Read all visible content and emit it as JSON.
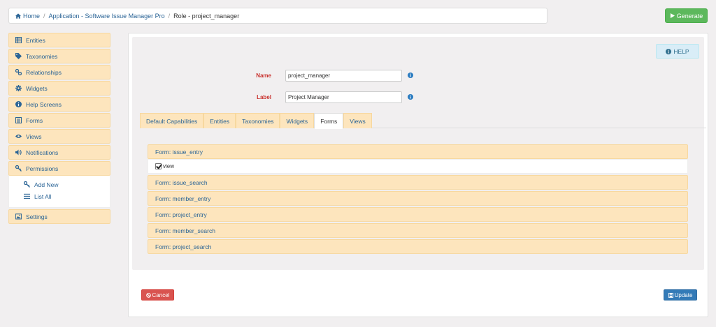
{
  "breadcrumb": {
    "home": "Home",
    "application": "Application - Software Issue Manager Pro",
    "current": "Role - project_manager"
  },
  "generate_label": "Generate",
  "sidebar": {
    "items": [
      {
        "label": "Entities",
        "icon": "table-icon"
      },
      {
        "label": "Taxonomies",
        "icon": "tag-icon"
      },
      {
        "label": "Relationships",
        "icon": "link-icon"
      },
      {
        "label": "Widgets",
        "icon": "gear-icon"
      },
      {
        "label": "Help Screens",
        "icon": "info-icon"
      },
      {
        "label": "Forms",
        "icon": "list-icon"
      },
      {
        "label": "Views",
        "icon": "eye-icon"
      },
      {
        "label": "Notifications",
        "icon": "volume-icon"
      },
      {
        "label": "Permissions",
        "icon": "key-icon"
      }
    ],
    "submenu": [
      {
        "label": "Add New",
        "icon": "key-icon"
      },
      {
        "label": "List All",
        "icon": "list-icon"
      }
    ],
    "settings": {
      "label": "Settings",
      "icon": "image-icon"
    }
  },
  "help_label": "HELP",
  "form": {
    "name_label": "Name",
    "name_value": "project_manager",
    "label_label": "Label",
    "label_value": "Project Manager"
  },
  "tabs": [
    "Default Capabilities",
    "Entities",
    "Taxonomies",
    "Widgets",
    "Forms",
    "Views"
  ],
  "active_tab": "Forms",
  "accordion": [
    {
      "title": "Form: issue_entry",
      "expanded": true,
      "option": "view",
      "checked": true
    },
    {
      "title": "Form: issue_search"
    },
    {
      "title": "Form: member_entry"
    },
    {
      "title": "Form: project_entry"
    },
    {
      "title": "Form: member_search"
    },
    {
      "title": "Form: project_search"
    }
  ],
  "cancel_label": "Cancel",
  "update_label": "Update",
  "colors": {
    "accent": "#fde5bd",
    "link": "#2a6496",
    "success": "#5cb85c",
    "danger": "#d9534f",
    "primary": "#337ab7"
  }
}
